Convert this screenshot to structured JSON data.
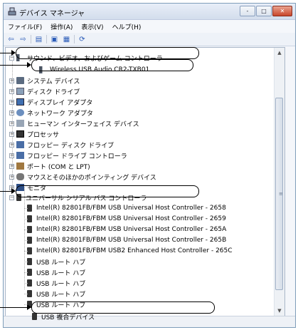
{
  "window": {
    "title": "デバイス マネージャ",
    "icon": "device-manager-icon",
    "buttons": {
      "minimize": "‐",
      "maximize": "□",
      "close": "✕"
    }
  },
  "menu": [
    "ファイル(F)",
    "操作(A)",
    "表示(V)",
    "ヘルプ(H)"
  ],
  "toolbar_icons": [
    "back-arrow-icon",
    "forward-arrow-icon",
    "view-icon",
    "help-icon",
    "properties-icon",
    "scan-icon"
  ],
  "tree": {
    "sound": {
      "label": "サウンド、ビデオ、およびゲーム コントローラ",
      "expander": "⊟"
    },
    "wireless": {
      "label": "Wireless USB Audio CR2-TXB01"
    },
    "categories": [
      {
        "label": "システム デバイス",
        "icon": "system-device-icon"
      },
      {
        "label": "ディスク ドライブ",
        "icon": "disk-drive-icon"
      },
      {
        "label": "ディスプレイ アダプタ",
        "icon": "display-adapter-icon"
      },
      {
        "label": "ネットワーク アダプタ",
        "icon": "network-adapter-icon"
      },
      {
        "label": "ヒューマン インターフェイス デバイス",
        "icon": "hid-icon"
      },
      {
        "label": "プロセッサ",
        "icon": "processor-icon"
      },
      {
        "label": "フロッピー ディスク ドライブ",
        "icon": "floppy-disk-drive-icon"
      },
      {
        "label": "フロッピー ドライブ コントローラ",
        "icon": "floppy-controller-icon"
      },
      {
        "label": "ポート (COM と LPT)",
        "icon": "port-icon"
      },
      {
        "label": "マウスとそのほかのポインティング デバイス",
        "icon": "mouse-icon"
      },
      {
        "label": "モニタ",
        "icon": "monitor-icon"
      }
    ],
    "usb": {
      "label": "ユニバーサル シリアル バス コントローラ",
      "expander": "⊟"
    },
    "usb_children": [
      "Intel(R) 82801FB/FBM USB Universal Host Controller - 2658",
      "Intel(R) 82801FB/FBM USB Universal Host Controller - 2659",
      "Intel(R) 82801FB/FBM USB Universal Host Controller - 265A",
      "Intel(R) 82801FB/FBM USB Universal Host Controller - 265B",
      "Intel(R) 82801FB/FBM USB2 Enhanced Host Controller - 265C",
      "USB ルート ハブ",
      "USB ルート ハブ",
      "USB ルート ハブ",
      "USB ルート ハブ",
      "USB ルート ハブ",
      "USB 複合デバイス"
    ]
  },
  "scrollbar": {
    "up": "▲",
    "down": "▼",
    "grip": "≡"
  }
}
